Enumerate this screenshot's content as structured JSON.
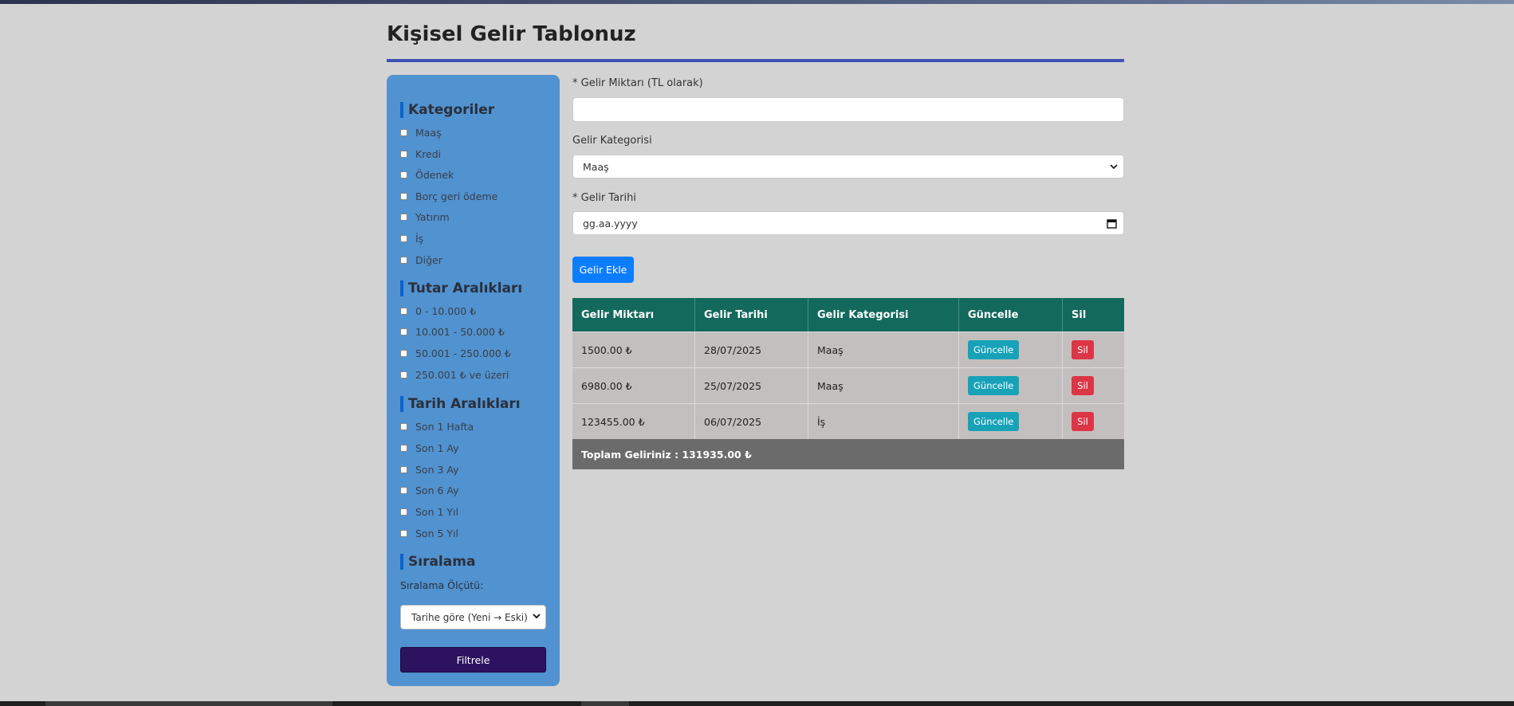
{
  "page": {
    "title": "Kişisel Gelir Tablonuz"
  },
  "sidebar": {
    "categories": {
      "heading": "Kategoriler",
      "items": [
        "Maaş",
        "Kredi",
        "Ödenek",
        "Borç geri ödeme",
        "Yatırım",
        "İş",
        "Diğer"
      ]
    },
    "amount_ranges": {
      "heading": "Tutar Aralıkları",
      "items": [
        "0 - 10.000 ₺",
        "10.001 - 50.000 ₺",
        "50.001 - 250.000 ₺",
        "250.001 ₺ ve üzeri"
      ]
    },
    "date_ranges": {
      "heading": "Tarih Aralıkları",
      "items": [
        "Son 1 Hafta",
        "Son 1 Ay",
        "Son 3 Ay",
        "Son 6 Ay",
        "Son 1 Yıl",
        "Son 5 Yıl"
      ]
    },
    "sorting": {
      "heading": "Sıralama",
      "label": "Sıralama Ölçütü:",
      "selected": "Tarihe göre (Yeni → Eski)"
    },
    "filter_button": "Filtrele"
  },
  "form": {
    "amount_label": "* Gelir Miktarı (TL olarak)",
    "amount_value": "",
    "category_label": "Gelir Kategorisi",
    "category_selected": "Maaş",
    "date_label": "* Gelir Tarihi",
    "date_placeholder": "gg.aa.yyyy",
    "add_button": "Gelir Ekle"
  },
  "table": {
    "headers": [
      "Gelir Miktarı",
      "Gelir Tarihi",
      "Gelir Kategorisi",
      "Güncelle",
      "Sil"
    ],
    "rows": [
      {
        "amount": "1500.00 ₺",
        "date": "28/07/2025",
        "category": "Maaş",
        "update": "Güncelle",
        "delete": "Sil"
      },
      {
        "amount": "6980.00 ₺",
        "date": "25/07/2025",
        "category": "Maaş",
        "update": "Güncelle",
        "delete": "Sil"
      },
      {
        "amount": "123455.00 ₺",
        "date": "06/07/2025",
        "category": "İş",
        "update": "Güncelle",
        "delete": "Sil"
      }
    ],
    "total": "Toplam Geliriniz : 131935.00 ₺"
  },
  "colors": {
    "background": "#d3d3d3",
    "sidebar": "#5192d0",
    "title_rule": "#3f51b5",
    "table_header": "#12695c",
    "update_button": "#17a2b8",
    "delete_button": "#dc3545",
    "add_button": "#0d7dff",
    "filter_button": "#2d1260",
    "total_row": "#6b6b6b"
  },
  "icons": {
    "select_arrow": "chevron-down-icon",
    "date_picker": "calendar-icon"
  }
}
